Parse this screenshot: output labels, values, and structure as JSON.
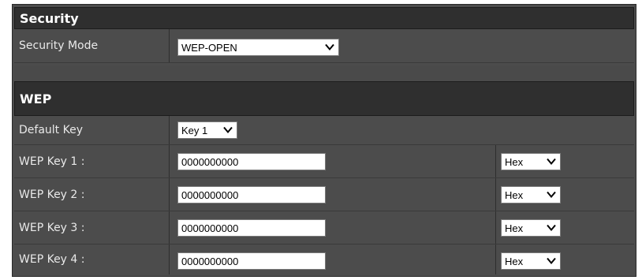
{
  "security": {
    "header": "Security",
    "mode_label": "Security Mode",
    "mode_value": "WEP-OPEN"
  },
  "wep": {
    "header": "WEP",
    "default_key_label": "Default Key",
    "default_key_value": "Key 1",
    "keys": [
      {
        "label": "WEP Key 1 :",
        "value": "0000000000",
        "format": "Hex"
      },
      {
        "label": "WEP Key 2 :",
        "value": "0000000000",
        "format": "Hex"
      },
      {
        "label": "WEP Key 3 :",
        "value": "0000000000",
        "format": "Hex"
      },
      {
        "label": "WEP Key 4 :",
        "value": "0000000000",
        "format": "Hex"
      }
    ]
  },
  "icons": {
    "dropdown": "chevron-down-icon"
  },
  "colors": {
    "panel": "#4c4c4c",
    "header": "#2f2f2f",
    "label_text": "#e9e9e9"
  }
}
